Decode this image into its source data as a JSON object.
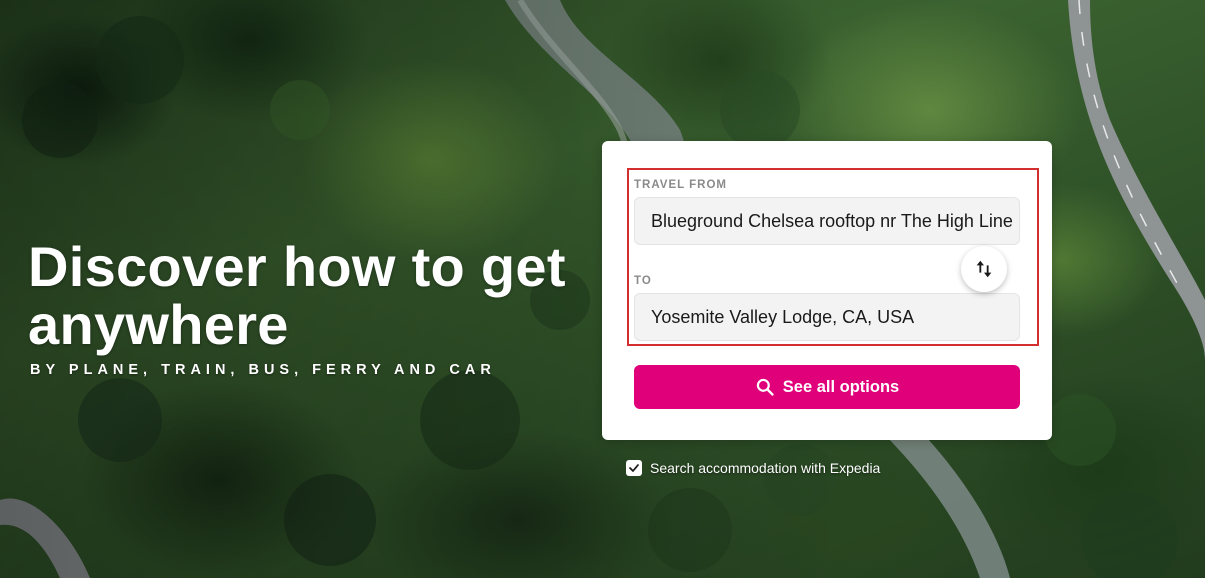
{
  "hero": {
    "headline": "Discover how to get anywhere",
    "subline": "BY PLANE, TRAIN, BUS, FERRY AND CAR"
  },
  "search": {
    "from_label": "TRAVEL FROM",
    "from_value": "Blueground Chelsea rooftop nr The High Line",
    "to_label": "TO",
    "to_value": "Yosemite Valley Lodge, CA, USA",
    "swap_icon": "swap-vertical-icon",
    "submit_label": "See all options",
    "submit_icon": "search-icon"
  },
  "accommodation": {
    "label": "Search accommodation with Expedia",
    "checked": true
  },
  "colors": {
    "accent": "#e0007a",
    "highlight": "#d32f2f"
  }
}
